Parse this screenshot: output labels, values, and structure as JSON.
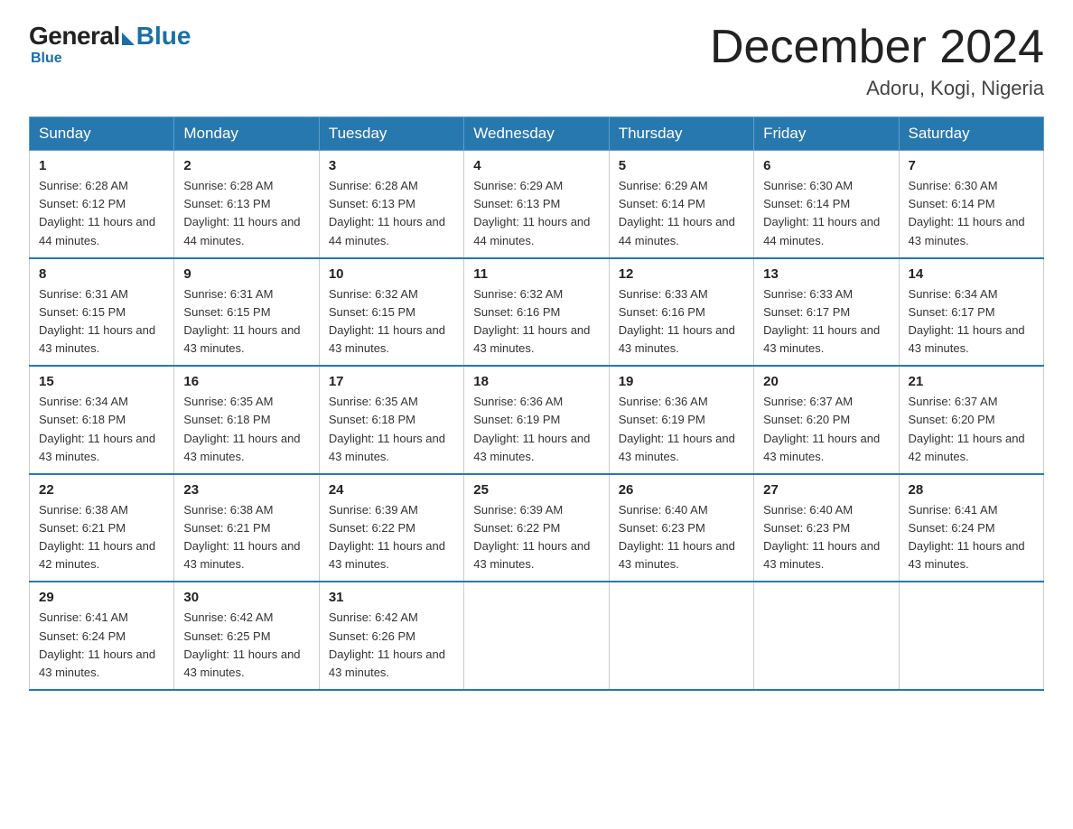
{
  "logo": {
    "general": "General",
    "blue": "Blue"
  },
  "title": "December 2024",
  "subtitle": "Adoru, Kogi, Nigeria",
  "weekdays": [
    "Sunday",
    "Monday",
    "Tuesday",
    "Wednesday",
    "Thursday",
    "Friday",
    "Saturday"
  ],
  "weeks": [
    [
      {
        "day": "1",
        "sunrise": "6:28 AM",
        "sunset": "6:12 PM",
        "daylight": "11 hours and 44 minutes."
      },
      {
        "day": "2",
        "sunrise": "6:28 AM",
        "sunset": "6:13 PM",
        "daylight": "11 hours and 44 minutes."
      },
      {
        "day": "3",
        "sunrise": "6:28 AM",
        "sunset": "6:13 PM",
        "daylight": "11 hours and 44 minutes."
      },
      {
        "day": "4",
        "sunrise": "6:29 AM",
        "sunset": "6:13 PM",
        "daylight": "11 hours and 44 minutes."
      },
      {
        "day": "5",
        "sunrise": "6:29 AM",
        "sunset": "6:14 PM",
        "daylight": "11 hours and 44 minutes."
      },
      {
        "day": "6",
        "sunrise": "6:30 AM",
        "sunset": "6:14 PM",
        "daylight": "11 hours and 44 minutes."
      },
      {
        "day": "7",
        "sunrise": "6:30 AM",
        "sunset": "6:14 PM",
        "daylight": "11 hours and 43 minutes."
      }
    ],
    [
      {
        "day": "8",
        "sunrise": "6:31 AM",
        "sunset": "6:15 PM",
        "daylight": "11 hours and 43 minutes."
      },
      {
        "day": "9",
        "sunrise": "6:31 AM",
        "sunset": "6:15 PM",
        "daylight": "11 hours and 43 minutes."
      },
      {
        "day": "10",
        "sunrise": "6:32 AM",
        "sunset": "6:15 PM",
        "daylight": "11 hours and 43 minutes."
      },
      {
        "day": "11",
        "sunrise": "6:32 AM",
        "sunset": "6:16 PM",
        "daylight": "11 hours and 43 minutes."
      },
      {
        "day": "12",
        "sunrise": "6:33 AM",
        "sunset": "6:16 PM",
        "daylight": "11 hours and 43 minutes."
      },
      {
        "day": "13",
        "sunrise": "6:33 AM",
        "sunset": "6:17 PM",
        "daylight": "11 hours and 43 minutes."
      },
      {
        "day": "14",
        "sunrise": "6:34 AM",
        "sunset": "6:17 PM",
        "daylight": "11 hours and 43 minutes."
      }
    ],
    [
      {
        "day": "15",
        "sunrise": "6:34 AM",
        "sunset": "6:18 PM",
        "daylight": "11 hours and 43 minutes."
      },
      {
        "day": "16",
        "sunrise": "6:35 AM",
        "sunset": "6:18 PM",
        "daylight": "11 hours and 43 minutes."
      },
      {
        "day": "17",
        "sunrise": "6:35 AM",
        "sunset": "6:18 PM",
        "daylight": "11 hours and 43 minutes."
      },
      {
        "day": "18",
        "sunrise": "6:36 AM",
        "sunset": "6:19 PM",
        "daylight": "11 hours and 43 minutes."
      },
      {
        "day": "19",
        "sunrise": "6:36 AM",
        "sunset": "6:19 PM",
        "daylight": "11 hours and 43 minutes."
      },
      {
        "day": "20",
        "sunrise": "6:37 AM",
        "sunset": "6:20 PM",
        "daylight": "11 hours and 43 minutes."
      },
      {
        "day": "21",
        "sunrise": "6:37 AM",
        "sunset": "6:20 PM",
        "daylight": "11 hours and 42 minutes."
      }
    ],
    [
      {
        "day": "22",
        "sunrise": "6:38 AM",
        "sunset": "6:21 PM",
        "daylight": "11 hours and 42 minutes."
      },
      {
        "day": "23",
        "sunrise": "6:38 AM",
        "sunset": "6:21 PM",
        "daylight": "11 hours and 43 minutes."
      },
      {
        "day": "24",
        "sunrise": "6:39 AM",
        "sunset": "6:22 PM",
        "daylight": "11 hours and 43 minutes."
      },
      {
        "day": "25",
        "sunrise": "6:39 AM",
        "sunset": "6:22 PM",
        "daylight": "11 hours and 43 minutes."
      },
      {
        "day": "26",
        "sunrise": "6:40 AM",
        "sunset": "6:23 PM",
        "daylight": "11 hours and 43 minutes."
      },
      {
        "day": "27",
        "sunrise": "6:40 AM",
        "sunset": "6:23 PM",
        "daylight": "11 hours and 43 minutes."
      },
      {
        "day": "28",
        "sunrise": "6:41 AM",
        "sunset": "6:24 PM",
        "daylight": "11 hours and 43 minutes."
      }
    ],
    [
      {
        "day": "29",
        "sunrise": "6:41 AM",
        "sunset": "6:24 PM",
        "daylight": "11 hours and 43 minutes."
      },
      {
        "day": "30",
        "sunrise": "6:42 AM",
        "sunset": "6:25 PM",
        "daylight": "11 hours and 43 minutes."
      },
      {
        "day": "31",
        "sunrise": "6:42 AM",
        "sunset": "6:26 PM",
        "daylight": "11 hours and 43 minutes."
      },
      null,
      null,
      null,
      null
    ]
  ]
}
